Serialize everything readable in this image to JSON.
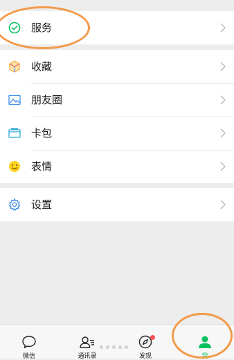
{
  "menu": {
    "service": {
      "label": "服务",
      "icon": "wechat-pay-icon"
    },
    "items": [
      {
        "label": "收藏",
        "icon": "favorites-cube-icon"
      },
      {
        "label": "朋友圈",
        "icon": "moments-image-icon"
      },
      {
        "label": "卡包",
        "icon": "card-wallet-icon"
      },
      {
        "label": "表情",
        "icon": "sticker-smile-icon"
      }
    ],
    "settings": {
      "label": "设置",
      "icon": "gear-icon"
    }
  },
  "tabbar": {
    "tabs": [
      {
        "label": "微信",
        "icon": "chat-bubble-icon"
      },
      {
        "label": "通讯录",
        "icon": "contacts-icon"
      },
      {
        "label": "发现",
        "icon": "compass-icon"
      },
      {
        "label": "我",
        "icon": "me-person-icon"
      }
    ],
    "active_index": 3
  },
  "colors": {
    "accent_green": "#07c160",
    "highlight_orange": "#f39a4a",
    "badge_red": "#fa5151"
  }
}
